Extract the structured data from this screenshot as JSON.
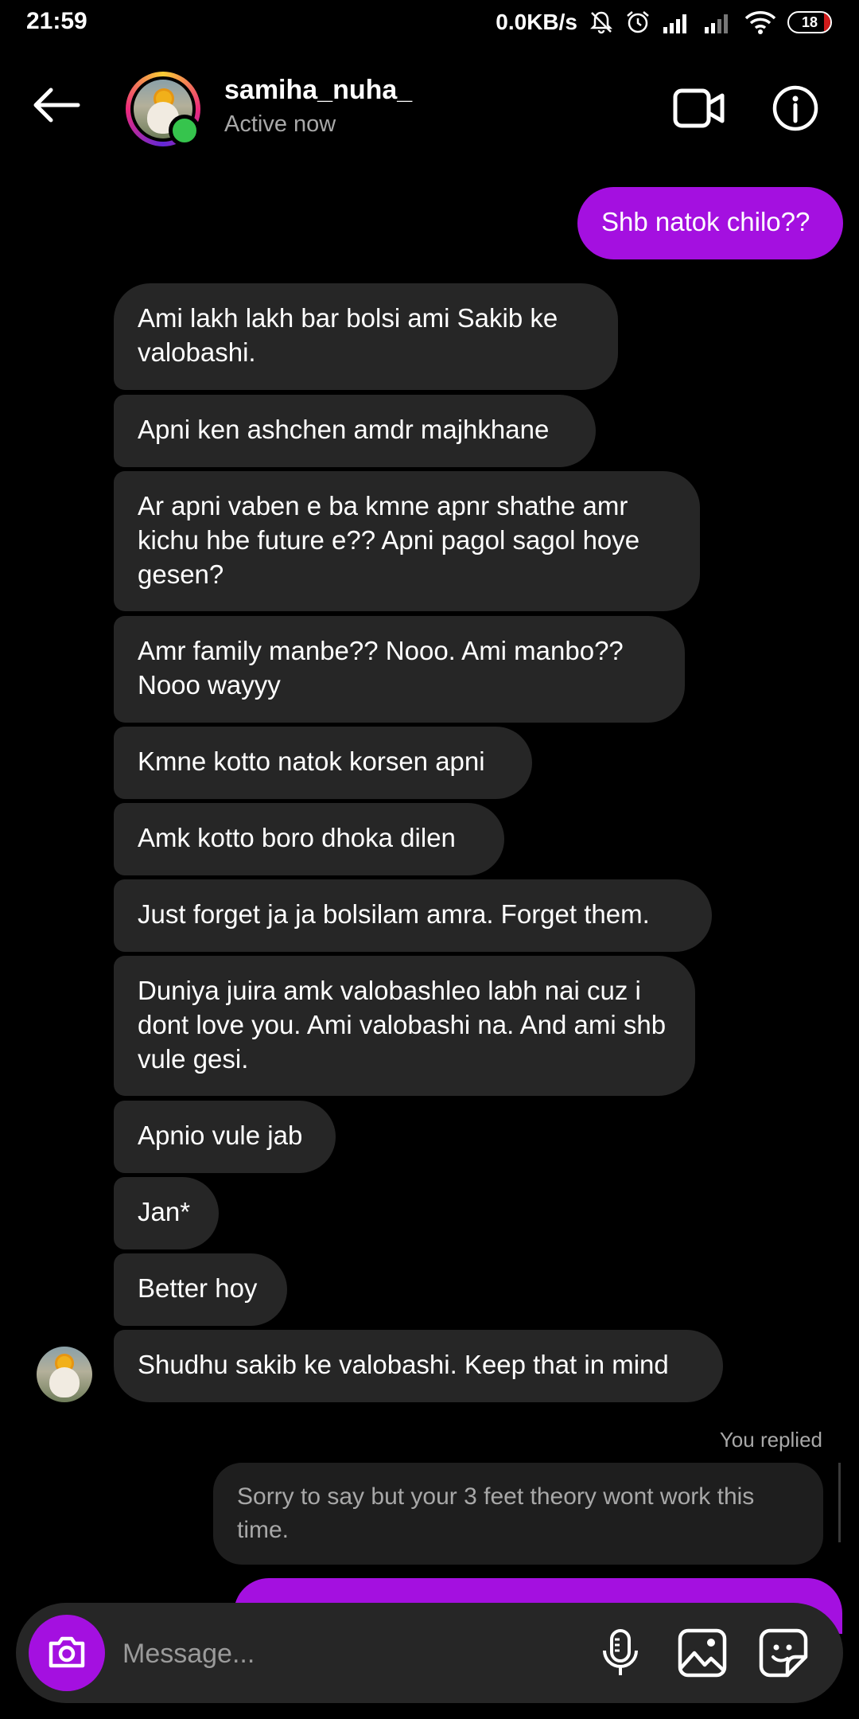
{
  "status_bar": {
    "time": "21:59",
    "network_speed": "0.0KB/s",
    "battery": "18",
    "icons": [
      "mute-icon",
      "alarm-icon",
      "signal-icon",
      "signal-icon",
      "wifi-icon",
      "battery-icon"
    ]
  },
  "header": {
    "username": "samiha_nuha_",
    "presence": "Active now",
    "icons": [
      "back-arrow-icon",
      "video-call-icon",
      "info-icon"
    ]
  },
  "messages": {
    "m0": "Shb natok chilo??",
    "m1": "Ami lakh lakh bar bolsi ami Sakib ke valobashi.",
    "m2": "Apni ken ashchen amdr majhkhane",
    "m3": "Ar apni vaben e ba kmne apnr shathe amr kichu hbe future e?? Apni pagol sagol hoye gesen?",
    "m4": "Amr family manbe?? Nooo. Ami manbo?? Nooo wayyy",
    "m5": "Kmne kotto natok korsen apni",
    "m6": "Amk kotto boro dhoka dilen",
    "m7": "Just forget ja ja bolsilam amra. Forget them.",
    "m8": "Duniya juira amk valobashleo labh nai cuz i dont love you. Ami valobashi na. And ami shb vule gesi.",
    "m9": "Apnio vule jab",
    "m10": "Jan*",
    "m11": "Better hoy",
    "m12": "Shudhu sakib ke valobashi. Keep that in mind"
  },
  "reply": {
    "label": "You replied",
    "quoted": "Sorry to say but your 3 feet theory wont work this time."
  },
  "composer": {
    "placeholder": "Message...",
    "icons": [
      "camera-icon",
      "microphone-icon",
      "gallery-icon",
      "sticker-icon"
    ]
  },
  "colors": {
    "accent": "#a410e0",
    "incoming_bubble": "#262626",
    "background": "#000000",
    "online": "#36c44d"
  }
}
